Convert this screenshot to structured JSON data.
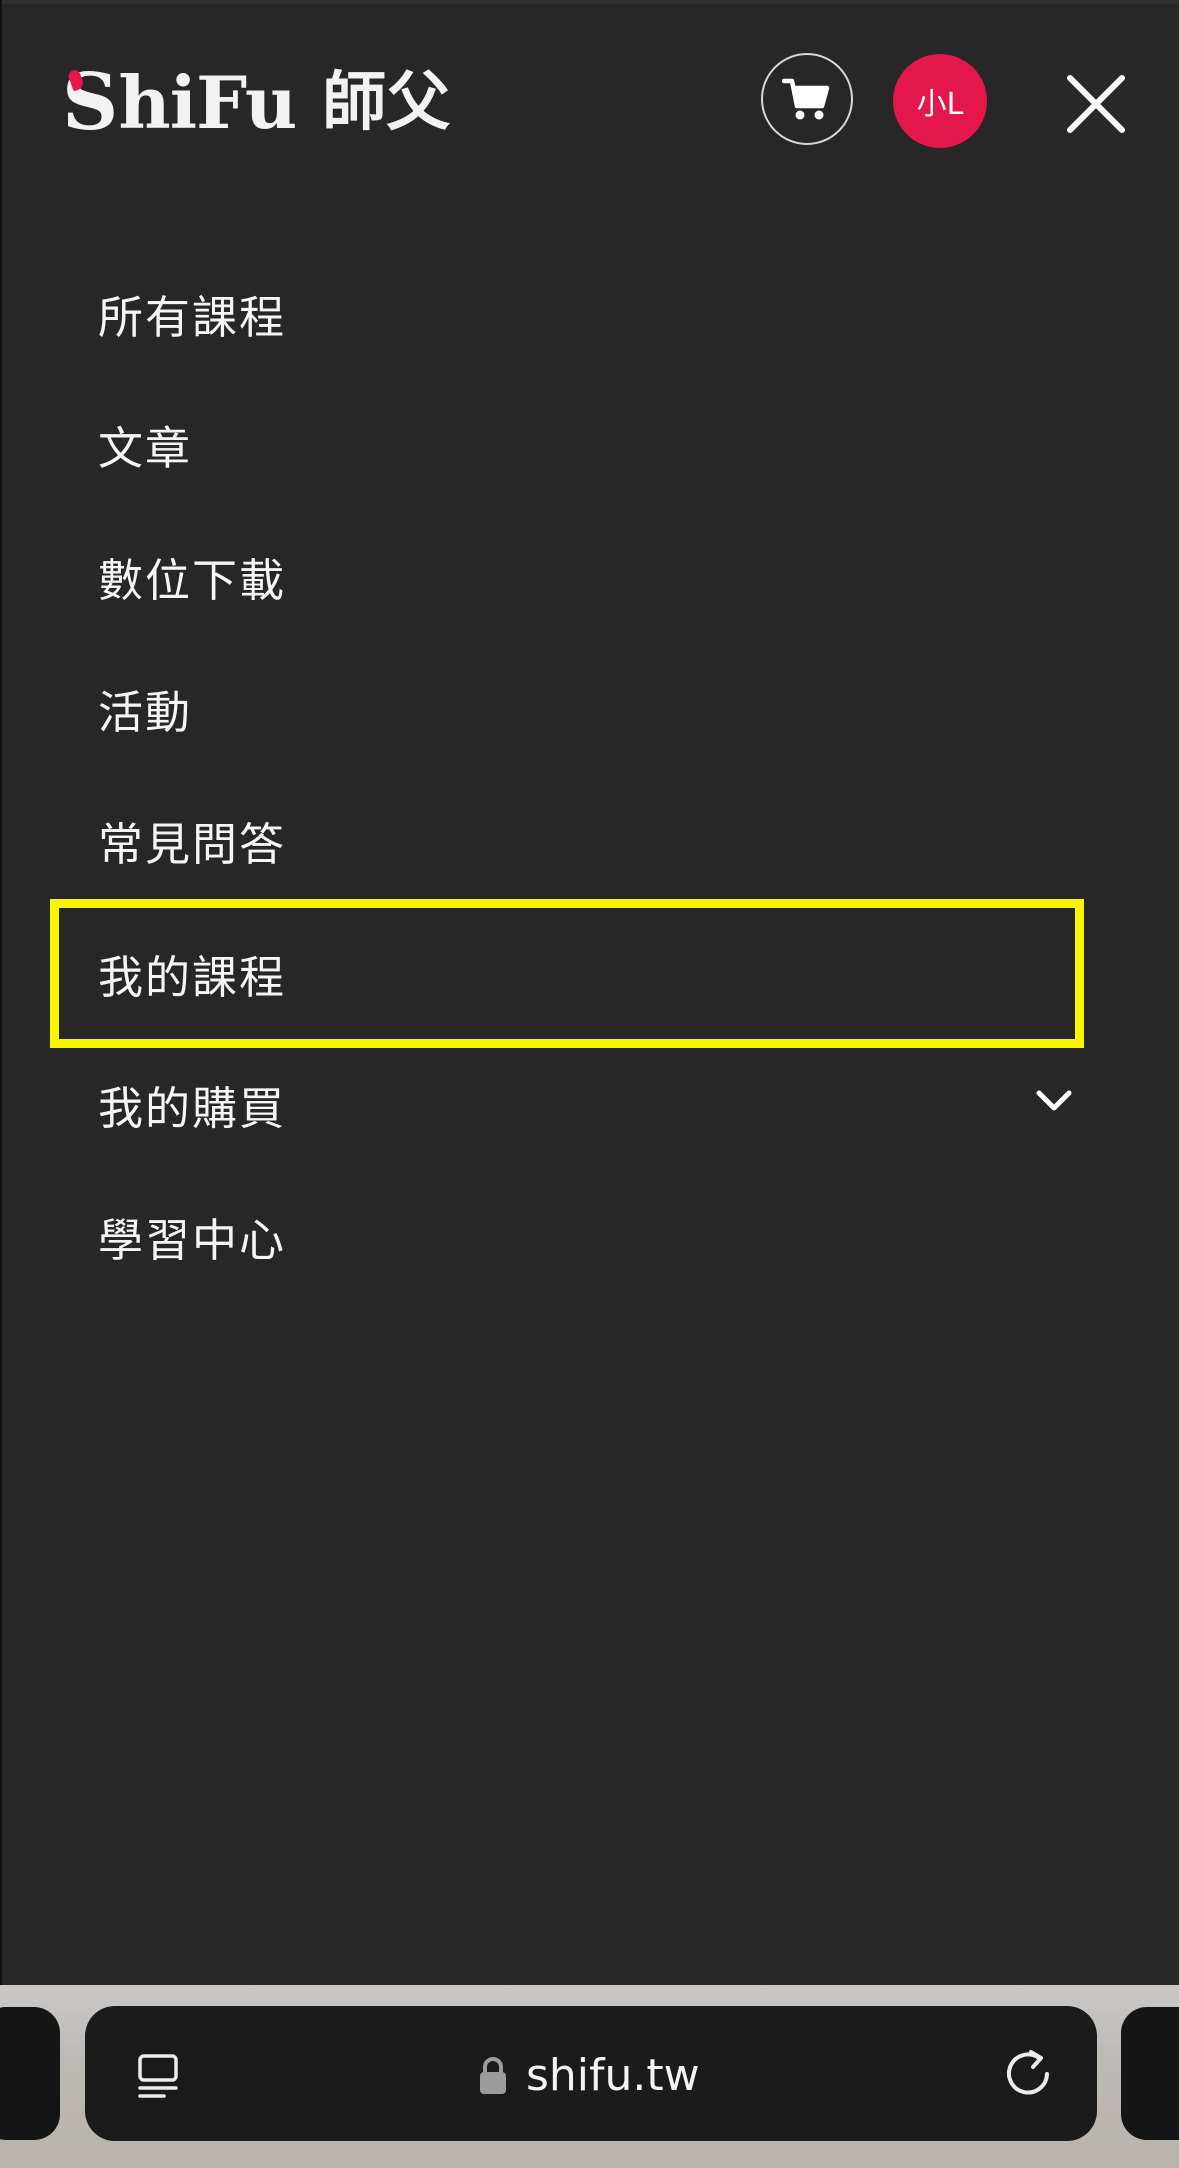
{
  "header": {
    "logo_text": "ShiFu",
    "logo_cn": "師父",
    "avatar_initials": "小L",
    "brand_color": "#e3174a",
    "icons": [
      "cart-icon",
      "close-icon"
    ]
  },
  "menu": {
    "items": [
      {
        "label": "所有課程"
      },
      {
        "label": "文章"
      },
      {
        "label": "數位下載"
      },
      {
        "label": "活動"
      },
      {
        "label": "常見問答"
      },
      {
        "label": "我的課程",
        "highlighted": true
      },
      {
        "label": "我的購買",
        "expandable": true
      },
      {
        "label": "學習中心"
      }
    ],
    "highlight_color": "#f7f500"
  },
  "browser": {
    "url": "shifu.tw",
    "icons": [
      "tabs-icon",
      "lock-icon",
      "reload-icon"
    ]
  }
}
